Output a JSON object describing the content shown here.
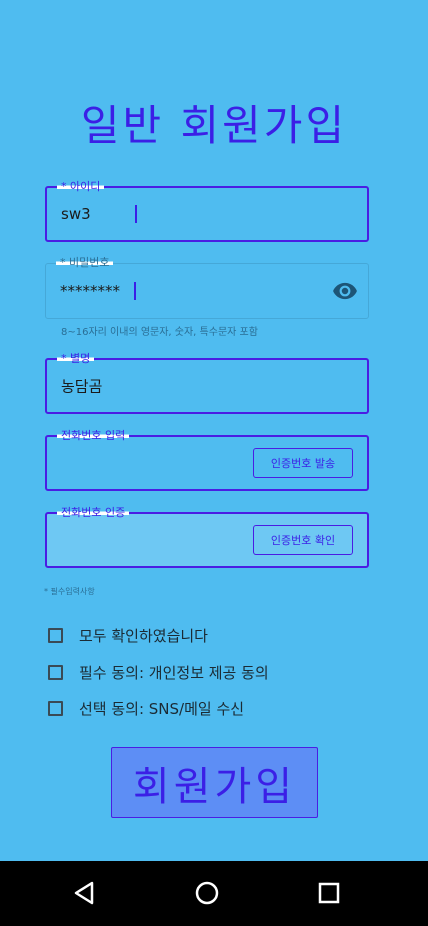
{
  "title": "일반 회원가입",
  "fields": {
    "id": {
      "label": "* 아이디",
      "value": "sw3"
    },
    "password": {
      "label": "* 비밀번호",
      "value": "********",
      "hint": "8~16자리 이내의 영문자, 숫자, 특수문자 포함",
      "icon": "eye-icon"
    },
    "nickname": {
      "label": "* 별명",
      "value": "농담곰"
    },
    "phone": {
      "label": "전화번호 입력",
      "value": "",
      "button": "인증번호 발송"
    },
    "verify": {
      "label": "전화번호 인증",
      "value": "",
      "button": "인증번호 확인"
    }
  },
  "required_note": "* 필수입력사항",
  "agreements": [
    {
      "label": "모두 확인하였습니다",
      "checked": false
    },
    {
      "label": "필수 동의: 개인정보 제공 동의",
      "checked": false
    },
    {
      "label": "선택 동의: SNS/메일 수신",
      "checked": false
    }
  ],
  "submit_label": "회원가입",
  "nav": {
    "back_icon": "back-icon",
    "home_icon": "home-icon",
    "recents_icon": "recents-icon"
  },
  "colors": {
    "background": "#4fbcf0",
    "accent": "#3b1fe6",
    "button_fill": "#5d8ef5",
    "navbar": "#000000"
  }
}
